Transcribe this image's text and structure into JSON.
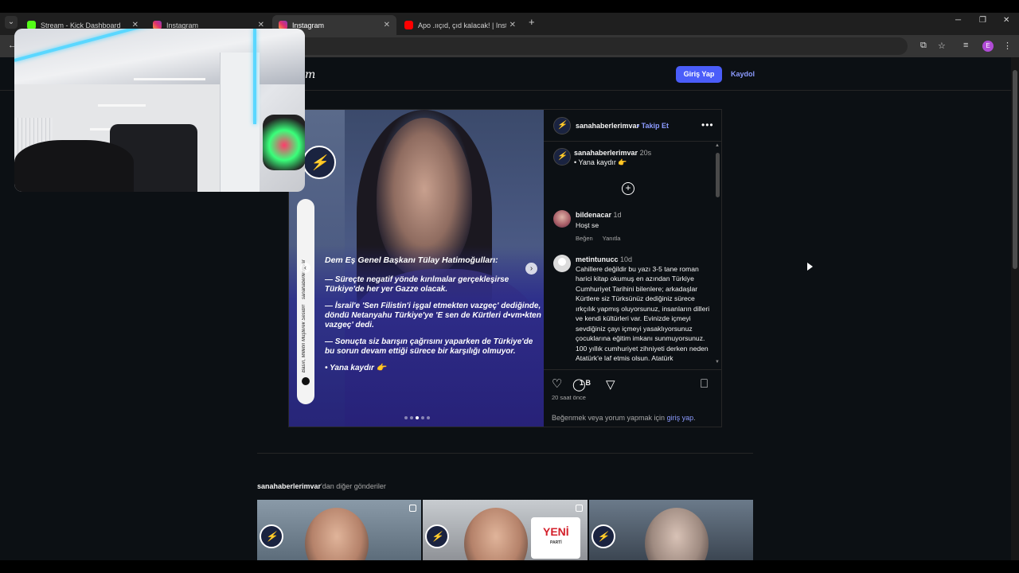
{
  "browser": {
    "tabs": [
      {
        "title": "Stream - Kick Dashboard",
        "favicon": "kick-icon",
        "active": false
      },
      {
        "title": "Instagram",
        "favicon": "instagram-icon",
        "active": false
      },
      {
        "title": "Instagram",
        "favicon": "instagram-icon",
        "active": true
      },
      {
        "title": "Apo .ııçıd, çıd kalacak! | InstaKa",
        "favicon": "youtube-icon",
        "active": false
      }
    ],
    "new_tab": "+",
    "profile_initial": "E"
  },
  "header": {
    "logo_fragment": "m",
    "login_label": "Giriş Yap",
    "signup_label": "Kaydol"
  },
  "post": {
    "account": "sanahaberlerimvar",
    "follow_label": "• Takip Et",
    "more_label": "•••",
    "badge_glyph": "⚡",
    "side_caption": "sanahaberlerimvar",
    "side_caption2": "Basın, Milletin Müşterek Sesidir!",
    "headline": {
      "title": "Dem Eş Genel Başkanı Tülay Hatimoğulları:",
      "lines": [
        "— Süreçte negatif yönde kırılmalar gerçekleşirse Türkiye'de her yer Gazze olacak.",
        "— İsrail'e 'Sen Filistin'i işgal etmekten vazgeç' dediğinde, döndü Netanyahu Türkiye'ye 'E sen de Kürtleri d•vm•kten vazgeç' dedi.",
        "— Sonuçta siz barışın çağrısını yaparken de Türkiye'de bu sorun devam ettiği sürece bir karşılığı olmuyor.",
        "• Yana kaydır 👉"
      ]
    },
    "carousel": {
      "current": 3,
      "total": 5
    },
    "caption": {
      "user": "sanahaberlerimvar",
      "time": "20s",
      "text": "• Yana kaydır 👉"
    },
    "comments": [
      {
        "user": "bildenacar",
        "time": "1d",
        "text": "Hoşt se",
        "actions": [
          "Beğen",
          "Yanıtla"
        ]
      },
      {
        "user": "metintunucc",
        "time": "10d",
        "text": "Cahillere değildir bu yazı 3-5 tane roman harici kitap okumuş en azından Türkiye Cumhuriyet Tarihini bilenlere; arkadaşlar Kürtlere siz Türksünüz dediğiniz sürece ırkçılık yapmış oluyorsunuz, insanların dilleri ve kendi kültürleri var. Evinizde içmeyi sevdiğiniz çayı içmeyi yasaklıyorsunuz çocuklarına eğitim imkanı sunmuyorsunuz. 100 yıllık cumhuriyet zihniyeti derken neden Atatürk'e laf etmis olsun. Atatürk"
      }
    ],
    "comment_count": "1 B",
    "time_ago": "20 saat önce",
    "login_prompt": "Beğenmek veya yorum yapmak için",
    "login_link": "giriş yap",
    "login_suffix": "."
  },
  "more_posts": {
    "account": "sanahaberlerimvar",
    "suffix": "'dan diğer gönderiler",
    "yeni": "YENİ",
    "yeni_sub": "PARTİ"
  }
}
